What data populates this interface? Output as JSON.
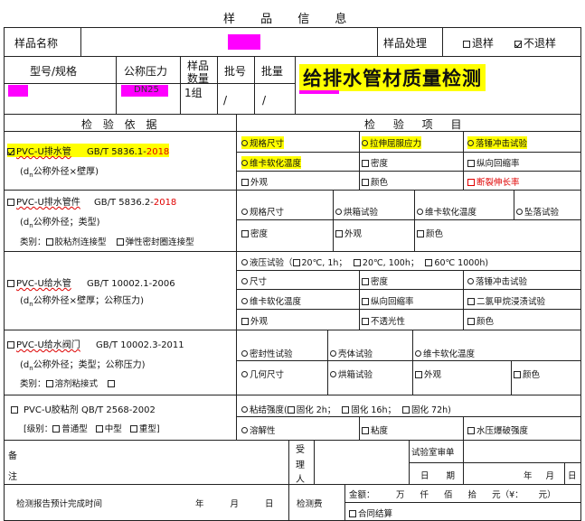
{
  "title": "样 品 信 息",
  "row1": {
    "sample_name_label": "样品名称",
    "handling_label": "样品处理",
    "return_label": "退样",
    "no_return_label": "不退样"
  },
  "row2": {
    "model_label": "型号/规格",
    "pressure_label": "公称压力",
    "pressure_value": "DN25",
    "qty_label_1": "样品",
    "qty_label_2": "数量",
    "qty_value": "1组",
    "batch_no_label": "批号",
    "batch_no_value": "/",
    "batch_qty_label": "批量",
    "batch_qty_value": "/",
    "banner": "给排水管材质量检测"
  },
  "headers": {
    "basis": "检 验 依 据",
    "items": "检 验 项 目"
  },
  "sec1": {
    "name": "PVC-U排水管",
    "std": "GB/T 5836.1-",
    "year": "2018",
    "note": "(d",
    "note_sub": "n",
    "note_rest": "公称外径×壁厚)",
    "items": [
      "规格尺寸",
      "拉伸屈服应力",
      "落锤冲击试验",
      "维卡软化温度",
      "密度",
      "纵向回缩率",
      "外观",
      "颜色",
      "断裂伸长率"
    ]
  },
  "sec2": {
    "name": "PVC-U排水管件",
    "std": "GB/T 5836.2-",
    "year": "2018",
    "note": "(d",
    "note_sub": "n",
    "note_rest": "公称外径；类型)",
    "cat_label": "类别：",
    "cat1": "胶粘剂连接型",
    "cat2": "弹性密封圈连接型",
    "items": [
      "规格尺寸",
      "烘箱试验",
      "维卡软化温度",
      "坠落试验",
      "密度",
      "外观",
      "颜色"
    ]
  },
  "sec3": {
    "name": "PVC-U给水管",
    "std": "GB/T 10002.1-2006",
    "note": "(d",
    "note_sub": "n",
    "note_rest": "公称外径×壁厚；公称压力)",
    "hydro": "液压试验（",
    "hydro_opts": [
      "20℃, 1h；",
      "20℃, 100h；",
      "60℃ 1000h)"
    ],
    "items": [
      "尺寸",
      "密度",
      "落锤冲击试验",
      "维卡软化温度",
      "纵向回缩率",
      "二氯甲烷浸渍试验",
      "外观",
      "不透光性",
      "颜色"
    ]
  },
  "sec4": {
    "name": "PVC-U给水阀门",
    "std": "GB/T 10002.3-2011",
    "note": "(d",
    "note_sub": "n",
    "note_rest": "公称外径；类型；公称压力)",
    "cat_label": "类别：",
    "cat1": "溶剂粘接式",
    "items": [
      "密封性试验",
      "壳体试验",
      "维卡软化温度",
      "几何尺寸",
      "烘箱试验",
      "外观",
      "颜色"
    ]
  },
  "sec5": {
    "name": "PVC-U胶粘剂 QB/T 2568-2002",
    "grade_label": "[级别：",
    "grade1": "普通型",
    "grade2": "中型",
    "grade3": "重型]",
    "strength": "粘结强度(",
    "strength_opts": [
      "固化 2h；",
      "固化 16h；",
      "固化 72h)"
    ],
    "items": [
      "溶解性",
      "粘度",
      "水压爆破强度"
    ]
  },
  "footer": {
    "remark_1": "备",
    "remark_2": "注",
    "receiver_1": "受",
    "receiver_2": "理",
    "receiver_3": "人",
    "lab_review": "试验室审单",
    "date_label": "日 期",
    "year_month_day": "年 月 日",
    "report_time_label": "检测报告预计完成时间",
    "report_date": "年 月 日",
    "fee_label": "检测费",
    "amount_label": "金额：",
    "amount_units": "万 仟 佰 拾 元（¥： 元）",
    "contract": "合同结算"
  }
}
